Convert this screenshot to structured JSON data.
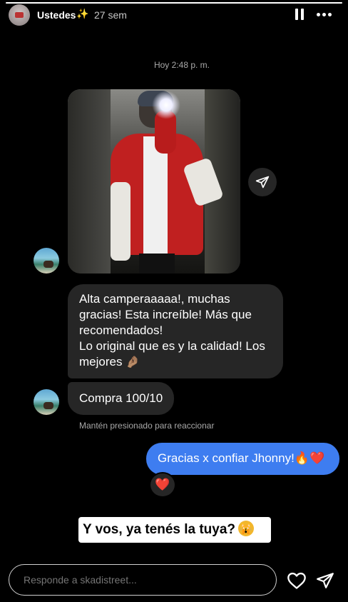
{
  "story": {
    "username": "Ustedes",
    "username_emoji": "✨",
    "time_ago": "27 sem",
    "progress_fraction": 1.0
  },
  "chat": {
    "timestamp": "Hoy 2:48 p. m.",
    "photo_alt": "photo",
    "messages": [
      {
        "from": "other",
        "lines": [
          "Alta camperaaaaa!, muchas",
          "gracias! Esta increíble! Más que",
          "recomendados!",
          "Lo original que es y la calidad! Los",
          "mejores"
        ],
        "trailing_emoji": "🤌🏽"
      },
      {
        "from": "other",
        "text": "Compra 100/10"
      }
    ],
    "hint": "Mantén presionado para reaccionar",
    "reply": {
      "text": "Gracias x confiar Jhonny!🔥❤️",
      "reaction": "❤️"
    }
  },
  "sticker": {
    "text": "Y vos, ya tenés la tuya?",
    "emoji": "🙀"
  },
  "footer": {
    "reply_placeholder": "Responde a skadistreet..."
  },
  "icons": {
    "pause": "pause-icon",
    "more": "more-icon",
    "share": "paper-plane-icon",
    "like": "heart-icon",
    "send": "paper-plane-icon"
  },
  "colors": {
    "background": "#000000",
    "incoming_bubble": "#262626",
    "outgoing_bubble": "#3e7df0",
    "reaction_heart": "#e8193c"
  }
}
